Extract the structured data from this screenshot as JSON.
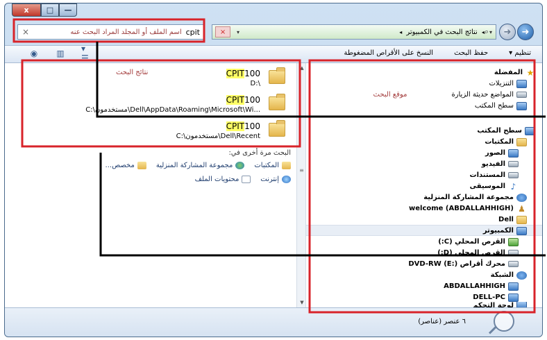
{
  "window": {
    "caption_buttons": {
      "close": "x",
      "maximize": "□",
      "minimize": "—"
    }
  },
  "address": {
    "breadcrumb_current": "نتائج البحث في الكمبيوتر",
    "search_value": "cpit",
    "search_hint": "اسم الملف أو المجلد المراد البحث عنه",
    "clear": "×",
    "stop": "×"
  },
  "toolbar": {
    "organize": "تنظيم ▾",
    "save_search": "حفظ البحث",
    "burn": "النسخ على الأقراص المضغوطة"
  },
  "results": [
    {
      "name_hl": "CPIT",
      "name_rest": "100",
      "path": "D:\\",
      "tag": "نتائج البحث"
    },
    {
      "name_hl": "CPIT",
      "name_rest": "100",
      "path": "C:\\مستخدمون\\Dell\\AppData\\Roaming\\Microsoft\\Wi...",
      "tag": ""
    },
    {
      "name_hl": "CPIT",
      "name_rest": "100",
      "path": "C:\\مستخدمون\\Dell\\Recent",
      "tag": ""
    }
  ],
  "search_again": {
    "title": "البحث مرة أخرى في:",
    "row1": [
      "المكتبات",
      "مجموعة المشاركة المنزلية",
      "مخصص..."
    ],
    "row2": [
      "إنترنت",
      "محتويات الملف"
    ]
  },
  "nav": {
    "favorites": "المفضلة",
    "downloads": "التنزيلات",
    "recent": "المواضع حديثة الزيارة",
    "recent_tag": "موقع البحث",
    "desktop_fav": "سطح المكتب",
    "desktop": "سطح المكتب",
    "libraries": "المكتبات",
    "pictures": "الصور",
    "videos": "الفيديو",
    "documents": "المستندات",
    "music": "الموسيقى",
    "homegroup": "مجموعة المشاركة المنزلية",
    "user": "welcome (ABDALLAHHIGH)",
    "dell": "Dell",
    "computer": "الكمبيوتر",
    "drive_c": "القرص المحلي (C:)",
    "drive_d": "القرص المحلي (D:)",
    "dvd": "محرك أقراص DVD-RW (E:)",
    "network": "الشبكة",
    "pc1": "ABDALLAHHIGH",
    "pc2": "DELL-PC",
    "control_panel": "لوحة التحكم"
  },
  "status": {
    "count": "٦ عنصر (عناصر)"
  },
  "colors": {
    "annotation_red": "#d8232a",
    "connector": "#000000",
    "highlight": "#ffff66"
  }
}
